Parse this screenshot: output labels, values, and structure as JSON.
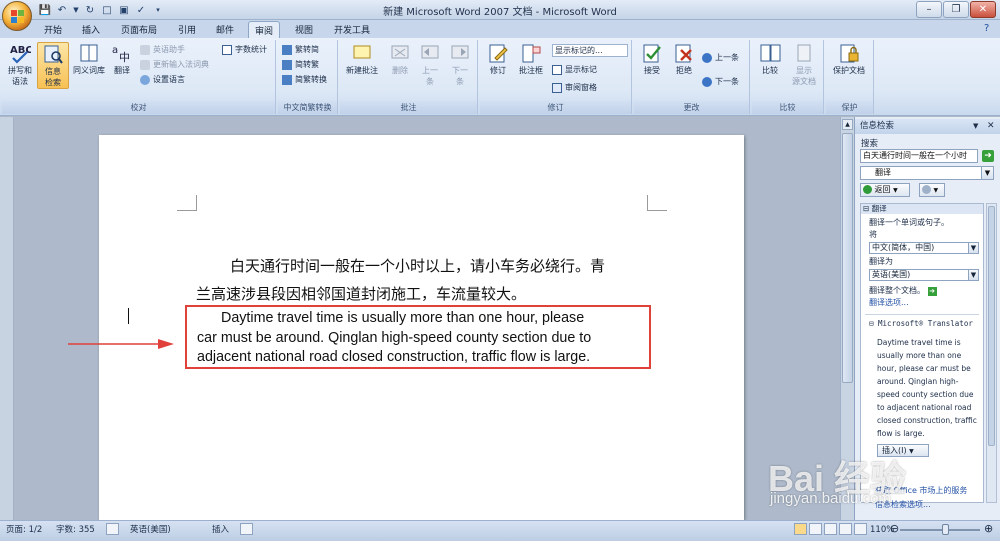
{
  "window": {
    "title": "新建 Microsoft Word 2007 文档 - Microsoft Word"
  },
  "tabs": [
    {
      "label": "开始"
    },
    {
      "label": "插入"
    },
    {
      "label": "页面布局"
    },
    {
      "label": "引用"
    },
    {
      "label": "邮件"
    },
    {
      "label": "审阅",
      "active": true
    },
    {
      "label": "视图"
    },
    {
      "label": "开发工具"
    }
  ],
  "ribbon": {
    "proofing": {
      "label": "校对",
      "spelling": "拼写和\n语法",
      "research": "信息\n检索",
      "thesaurus": "同义词库",
      "translate": "翻译",
      "translate_tip": "英语助手",
      "update_ime": "更新输入法词典",
      "word_count": "字数统计",
      "set_language": "设置语言"
    },
    "chinese_conversion": {
      "label": "中文简繁转换",
      "t2s": "繁转简",
      "s2t": "简转繁",
      "convert": "简繁转换"
    },
    "comments": {
      "label": "批注",
      "new": "新建批注",
      "delete": "删除",
      "prev": "上一\n条",
      "next": "下一\n条"
    },
    "tracking": {
      "label": "修订",
      "track": "修订",
      "balloons": "批注框",
      "display_select": "显示标记的...",
      "show_markup": "显示标记",
      "review_pane": "审阅窗格"
    },
    "changes": {
      "label": "更改",
      "accept": "接受",
      "reject": "拒绝",
      "previous": "上一条",
      "next": "下一条"
    },
    "compare": {
      "label": "比较",
      "compare": "比较",
      "show_source": "显示\n源文档"
    },
    "protect": {
      "label": "保护",
      "protect_doc": "保护文档"
    }
  },
  "document": {
    "chinese_lines": [
      "白天通行时间一般在一个小时以上，请小车务必绕行。青",
      "兰高速涉县段因相邻国道封闭施工，车流量较大。"
    ],
    "english_lines": [
      "Daytime travel time is usually more than one hour, please",
      "car must be around. Qinglan high-speed county section due to",
      "adjacent national road closed construction, traffic flow is large."
    ]
  },
  "research_pane": {
    "title": "信息检索",
    "search_label": "搜索",
    "search_value": "白天通行时间一般在一个小时",
    "service": "翻译",
    "back": "返回",
    "section_title": "翻译",
    "translate_sentence": "翻译一个单词或句子。",
    "from_label": "将",
    "from_value": "中文(简体，中国)",
    "to_label": "翻译为",
    "to_value": "英语(美国)",
    "translate_doc": "翻译整个文档。",
    "options": "翻译选项...",
    "provider": "Microsoft® Translator",
    "translation_lines": [
      "Daytime travel time is",
      "usually more than one",
      "hour, please car must be",
      "around. Qinglan high-",
      "speed county section due",
      "to adjacent national road",
      "closed construction, traffic",
      "flow is large."
    ],
    "insert": "插入(I)",
    "get_services": "获取 Office 市场上的服务",
    "options2": "信息检索选项..."
  },
  "status_bar": {
    "page": "页面: 1/2",
    "words": "字数: 355",
    "language": "英语(美国)",
    "insert_mode": "插入",
    "zoom": "110%"
  },
  "watermark": {
    "brand": "Bai 经验",
    "url": "jingyan.baidu.com"
  },
  "colors": {
    "highlight_box": "#e0413b",
    "arrow": "#e0413b",
    "ribbon_bg": "#dde8f6",
    "doc_bg": "#aebacb"
  }
}
